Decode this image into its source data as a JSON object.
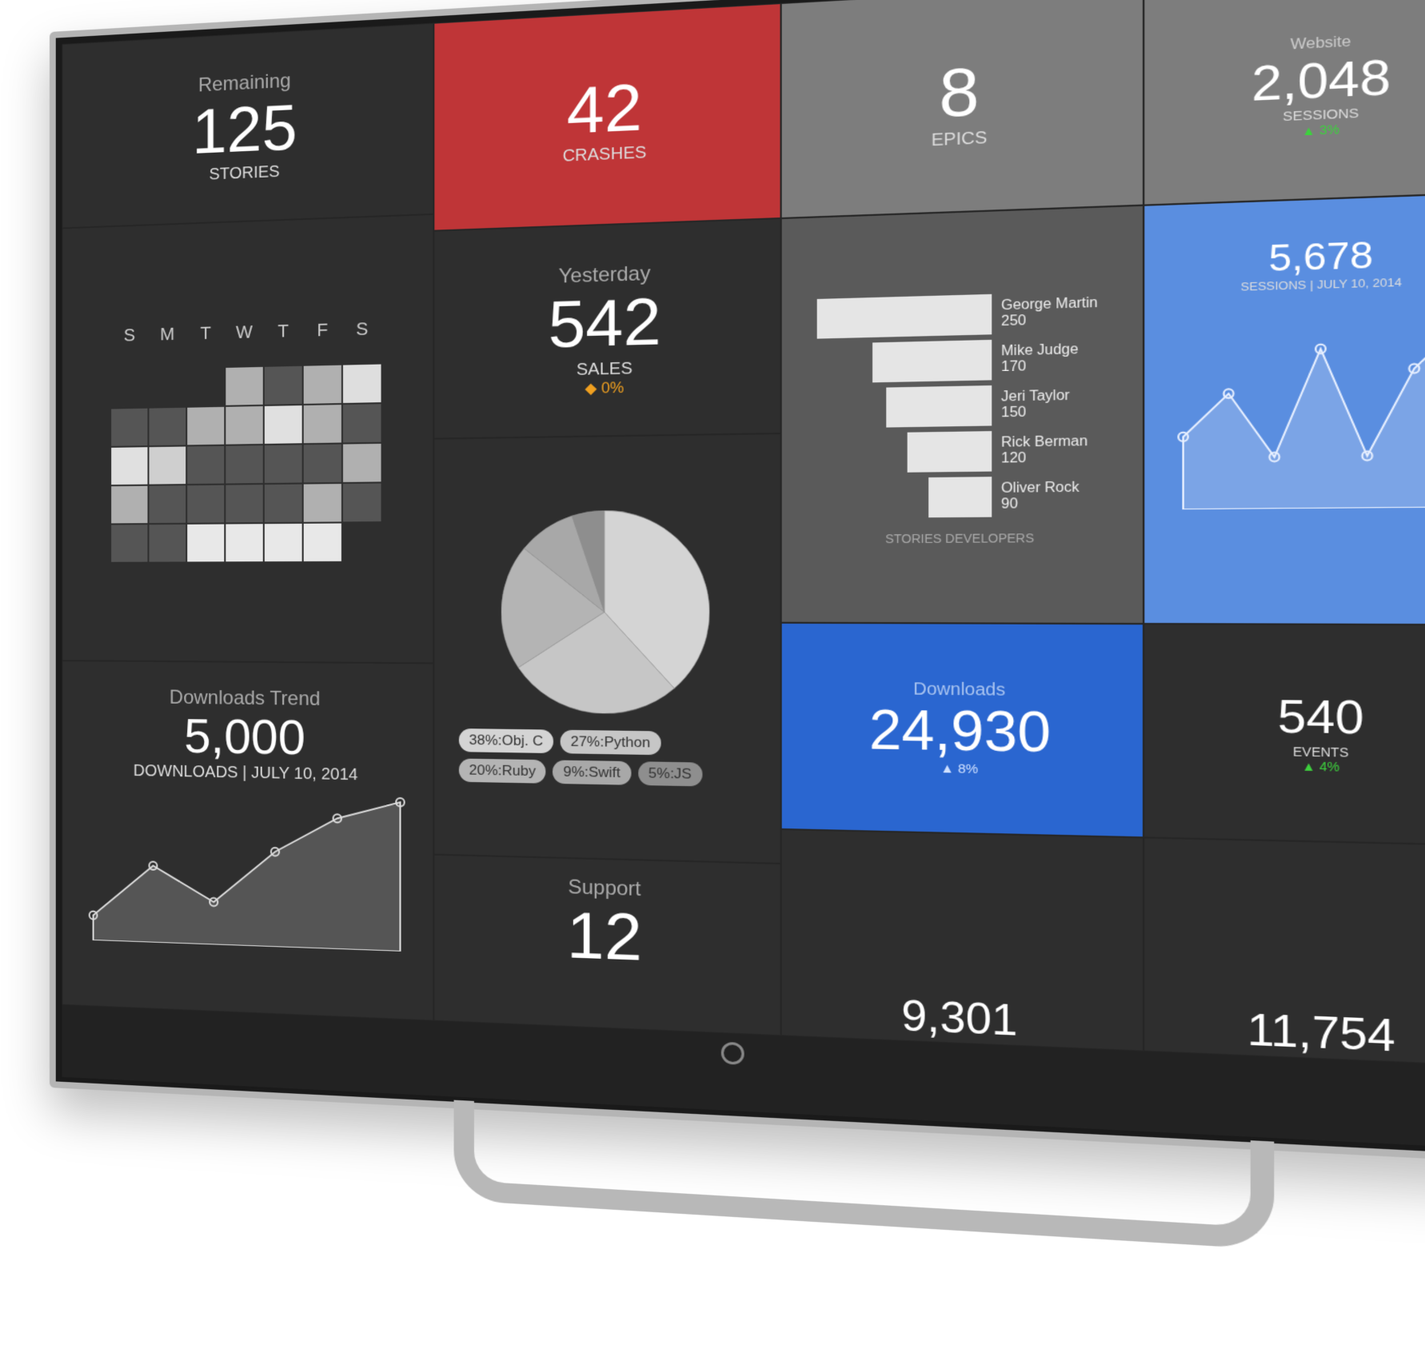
{
  "remaining": {
    "label": "Remaining",
    "value": "125",
    "unit": "STORIES"
  },
  "crashes": {
    "value": "42",
    "unit": "CRASHES",
    "color": "#bf3537"
  },
  "epics": {
    "value": "8",
    "unit": "EPICS"
  },
  "website": {
    "label": "Website",
    "value": "2,048",
    "unit": "SESSIONS",
    "change": "▲ 3%"
  },
  "calendar": {
    "days": [
      "S",
      "M",
      "T",
      "W",
      "T",
      "F",
      "S"
    ],
    "cells": [
      [
        null,
        null,
        null,
        "#b0b0b0",
        "#555",
        "#b0b0b0",
        "#dedede"
      ],
      [
        "#555",
        "#555",
        "#b0b0b0",
        "#b0b0b0",
        "#e0e0e0",
        "#b0b0b0",
        "#555"
      ],
      [
        "#e0e0e0",
        "#cfcfcf",
        "#555",
        "#555",
        "#555",
        "#555",
        "#b0b0b0"
      ],
      [
        "#b0b0b0",
        "#555",
        "#555",
        "#555",
        "#555",
        "#b0b0b0",
        "#555"
      ],
      [
        "#555",
        "#555",
        "#e8e8e8",
        "#e8e8e8",
        "#e8e8e8",
        "#e8e8e8",
        null
      ]
    ]
  },
  "yesterday": {
    "label": "Yesterday",
    "value": "542",
    "unit": "SALES",
    "change": "◆ 0%"
  },
  "developers": {
    "items": [
      {
        "name": "George Martin",
        "value": 250
      },
      {
        "name": "Mike Judge",
        "value": 170
      },
      {
        "name": "Jeri Taylor",
        "value": 150
      },
      {
        "name": "Rick Berman",
        "value": 120
      },
      {
        "name": "Oliver Rock",
        "value": 90
      }
    ],
    "footer": "STORIES   DEVELOPERS"
  },
  "sessions": {
    "value": "5,678",
    "unit": "SESSIONS",
    "date": "July 10, 2014",
    "trend": [
      3,
      5,
      2,
      7,
      2,
      6,
      8
    ]
  },
  "languages": {
    "slices": [
      {
        "label": "38%:Obj. C",
        "value": 38,
        "color": "#d4d4d4"
      },
      {
        "label": "27%:Python",
        "value": 27,
        "color": "#c6c6c6"
      },
      {
        "label": "20%:Ruby",
        "value": 20,
        "color": "#b4b4b4"
      },
      {
        "label": "9%:Swift",
        "value": 9,
        "color": "#a8a8a8"
      },
      {
        "label": "5%:JS",
        "value": 5,
        "color": "#8e8e8e"
      }
    ]
  },
  "downloads_trend": {
    "label": "Downloads Trend",
    "value": "5,000",
    "unit": "DOWNLOADS",
    "date": "July 10, 2014",
    "trend": [
      1,
      4,
      2,
      5,
      7,
      8
    ]
  },
  "downloads": {
    "label": "Downloads",
    "value": "24,930",
    "change": "▲ 8%"
  },
  "events": {
    "value": "540",
    "unit": "EVENTS",
    "change": "▲ 4%"
  },
  "support": {
    "label": "Support",
    "value": "12"
  },
  "tile_9301": {
    "value": "9,301"
  },
  "tile_11754": {
    "value": "11,754"
  }
}
